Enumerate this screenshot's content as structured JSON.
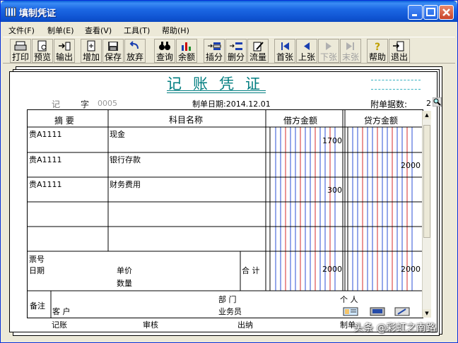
{
  "window": {
    "title": "填制凭证"
  },
  "menu": [
    "文件(F)",
    "制单(E)",
    "查看(V)",
    "工具(T)",
    "帮助(H)"
  ],
  "toolbar": {
    "print": "打印",
    "preview": "预览",
    "export": "输出",
    "add": "增加",
    "save": "保存",
    "discard": "放弃",
    "query": "查询",
    "balance": "余额",
    "insert_entry": "插分",
    "delete_entry": "删分",
    "flow": "流量",
    "first": "首张",
    "prev": "上张",
    "next": "下张",
    "last": "末张",
    "help": "帮助",
    "exit": "退出"
  },
  "voucher": {
    "title": "记账凭证",
    "type_label": "记",
    "no_label": "字",
    "no_value": "0005",
    "date_text": "制单日期:2014.12.01",
    "attachments_label": "附单据数:",
    "attachments_value": "2",
    "columns": {
      "summary": "摘  要",
      "account": "科目名称",
      "debit": "借方金额",
      "credit": "贷方金额"
    },
    "rows": [
      {
        "summary": "贵A1111",
        "account": "现金",
        "debit": "1700",
        "credit": ""
      },
      {
        "summary": "贵A1111",
        "account": "银行存款",
        "debit": "",
        "credit": "2000"
      },
      {
        "summary": "贵A1111",
        "account": "财务费用",
        "debit": "300",
        "credit": ""
      },
      {
        "summary": "",
        "account": "",
        "debit": "",
        "credit": ""
      },
      {
        "summary": "",
        "account": "",
        "debit": "",
        "credit": ""
      }
    ],
    "bill_no_label": "票号",
    "date_label": "日期",
    "unit_price_label": "单价",
    "quantity_label": "数量",
    "total_label": "合 计",
    "total_debit": "2000",
    "total_credit": "2000",
    "remark_label": "备注",
    "department_label": "部  门",
    "person_label": "个  人",
    "customer_label": "客  户",
    "salesman_label": "业务员"
  },
  "footer": {
    "bookkeeper": "记账",
    "auditor": "审核",
    "cashier": "出纳",
    "maker": "制单"
  },
  "watermark": "头条 @彩虹之南路"
}
